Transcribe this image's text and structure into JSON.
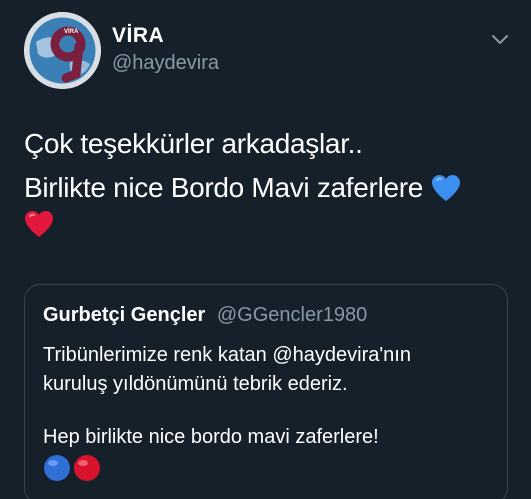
{
  "tweet": {
    "author": {
      "display_name": "VİRA",
      "handle": "@haydevira",
      "avatar": "vira-logo-avatar"
    },
    "menu_icon": "chevron-down-icon",
    "text_lines": [
      "Çok teşekkürler arkadaşlar..",
      "Birlikte nice Bordo Mavi zaferlere"
    ],
    "emojis": {
      "blue_heart": "blue-heart-icon",
      "red_heart": "red-heart-icon"
    }
  },
  "quote": {
    "display_name": "Gurbetçi Gençler",
    "handle": "@GGencler1980",
    "line1": "Tribünlerimize renk katan @haydevira'nın",
    "line2": "kuruluş yıldönümünü tebrik ederiz.",
    "line3": "Hep birlikte nice bordo mavi zaferlere!",
    "emojis": [
      "blue-circle-icon",
      "red-circle-icon"
    ]
  },
  "colors": {
    "background": "#15202b",
    "secondary_text": "#8899a6",
    "border": "#38444d",
    "blue_heart": "#3b8ff0",
    "red_heart": "#e3183c"
  }
}
